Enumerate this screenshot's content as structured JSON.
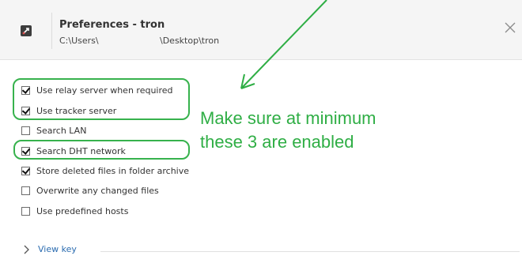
{
  "window": {
    "title": "Preferences - tron",
    "path_prefix": "C:\\Users\\",
    "path_suffix": "\\Desktop\\tron",
    "icon": "app-icon",
    "close_icon": "close-icon"
  },
  "options": [
    {
      "label": "Use relay server when required",
      "checked": true
    },
    {
      "label": "Use tracker server",
      "checked": true
    },
    {
      "label": "Search LAN",
      "checked": false
    },
    {
      "label": "Search DHT network",
      "checked": true
    },
    {
      "label": "Store deleted files in folder archive",
      "checked": true
    },
    {
      "label": "Overwrite any changed files",
      "checked": false
    },
    {
      "label": "Use predefined hosts",
      "checked": false
    }
  ],
  "annotation": {
    "line1": "Make sure at minimum",
    "line2": "these 3 are enabled",
    "color": "#2fae45"
  },
  "footer": {
    "view_key_label": "View key",
    "chevron_icon": "chevron-right-icon"
  }
}
